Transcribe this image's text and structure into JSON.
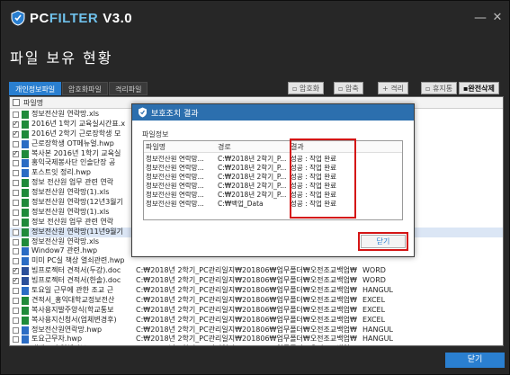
{
  "app": {
    "brand_pc": "PC",
    "brand_filter": "FILTER",
    "version": "V3.0",
    "page_title": "파일 보유 현황",
    "minimize_label": "—",
    "close_label": "✕"
  },
  "tabs": [
    {
      "label": "개인정보파일",
      "active": true
    },
    {
      "label": "암호화파일",
      "active": false
    },
    {
      "label": "격리파일",
      "active": false
    }
  ],
  "toolbar": {
    "encrypt": "암호화",
    "compress": "압축",
    "quarantine": "격리",
    "trash": "휴지통",
    "secure_delete": "완전삭제"
  },
  "list": {
    "header": "파일명",
    "rows": [
      {
        "name": "정보전산원 연락망.xls",
        "path": "",
        "type": "",
        "checked": false,
        "icon": "excel",
        "selected": false
      },
      {
        "name": "2016년 1학기 교육실시간표.x",
        "path": "",
        "type": "",
        "checked": true,
        "icon": "excel",
        "selected": false
      },
      {
        "name": "2016년 2학기 근로장학생 모",
        "path": "",
        "type": "",
        "checked": true,
        "icon": "excel",
        "selected": false
      },
      {
        "name": "근로장학생 OT메뉴얼.hwp",
        "path": "",
        "type": "",
        "checked": false,
        "icon": "hwp",
        "selected": false
      },
      {
        "name": "복사본 2016년 1학기 교육실",
        "path": "",
        "type": "",
        "checked": true,
        "icon": "excel",
        "selected": false
      },
      {
        "name": "홍익국제봉사단 인솔단장 공",
        "path": "",
        "type": "",
        "checked": false,
        "icon": "hwp",
        "selected": false
      },
      {
        "name": "포스트잇 정리.hwp",
        "path": "",
        "type": "",
        "checked": false,
        "icon": "hwp",
        "selected": false
      },
      {
        "name": "정보 전산원 업무 관련 연락",
        "path": "",
        "type": "",
        "checked": false,
        "icon": "excel",
        "selected": false
      },
      {
        "name": "정보전산원 연락망(1).xls",
        "path": "",
        "type": "",
        "checked": false,
        "icon": "excel",
        "selected": false
      },
      {
        "name": "정보전산원 연락망(12년3월기",
        "path": "",
        "type": "",
        "checked": false,
        "icon": "excel",
        "selected": false
      },
      {
        "name": "정보전산원 연락망(1).xls",
        "path": "",
        "type": "",
        "checked": false,
        "icon": "excel",
        "selected": false
      },
      {
        "name": "정보 전산원 업무 관련 연락",
        "path": "",
        "type": "",
        "checked": false,
        "icon": "excel",
        "selected": false
      },
      {
        "name": "정보전산원 연락망(11년9월기",
        "path": "",
        "type": "",
        "checked": false,
        "icon": "excel",
        "selected": true
      },
      {
        "name": "정보전산원 연락망.xls",
        "path": "",
        "type": "",
        "checked": false,
        "icon": "excel",
        "selected": false
      },
      {
        "name": "Window7 관련.hwp",
        "path": "",
        "type": "",
        "checked": false,
        "icon": "hwp",
        "selected": false
      },
      {
        "name": "미미 PC실 책상 열쇠관련.hwp",
        "path": "",
        "type": "",
        "checked": false,
        "icon": "hwp",
        "selected": false
      },
      {
        "name": "빔프로젝터 견적서(두강).doc",
        "path": "C:₩2018년 2학기_PC관리일지₩201806₩업무폴더₩오전조교백업₩",
        "type": "WORD",
        "checked": true,
        "icon": "word",
        "selected": false
      },
      {
        "name": "빔프로젝터 견적서(한솔).doc",
        "path": "C:₩2018년 2학기_PC관리일지₩201806₩업무폴더₩오전조교백업₩",
        "type": "WORD",
        "checked": true,
        "icon": "word",
        "selected": false
      },
      {
        "name": "토요일 근무에 관한 조교 근",
        "path": "C:₩2018년 2학기_PC관리일지₩201806₩업무폴더₩오전조교백업₩",
        "type": "HANGUL",
        "checked": false,
        "icon": "hwp",
        "selected": false
      },
      {
        "name": "견적서_홍익대학교정보전산",
        "path": "C:₩2018년 2학기_PC관리일지₩201806₩업무폴더₩오전조교백업₩",
        "type": "EXCEL",
        "checked": false,
        "icon": "excel",
        "selected": false
      },
      {
        "name": "복사용지발주양식(학교통보",
        "path": "C:₩2018년 2학기_PC관리일지₩201806₩업무폴더₩오전조교백업₩",
        "type": "EXCEL",
        "checked": false,
        "icon": "excel",
        "selected": false
      },
      {
        "name": "복사용지신청서(업체변경후)",
        "path": "C:₩2018년 2학기_PC관리일지₩201806₩업무폴더₩오전조교백업₩",
        "type": "EXCEL",
        "checked": false,
        "icon": "excel",
        "selected": false
      },
      {
        "name": "정보전산원연락망.hwp",
        "path": "C:₩2018년 2학기_PC관리일지₩201806₩업무폴더₩오전조교백업₩",
        "type": "HANGUL",
        "checked": false,
        "icon": "hwp",
        "selected": false
      },
      {
        "name": "토요근무자.hwp",
        "path": "C:₩2018년 2학기_PC관리일지₩201806₩업무폴더₩오전조교백업₩",
        "type": "HANGUL",
        "checked": false,
        "icon": "hwp",
        "selected": false
      },
      {
        "name": "재생토너 업체정보.xls",
        "path": "C:₩2018년 2학기_PC관리일지₩201806₩업무폴더₩오전조교백업₩",
        "type": "EXCEL",
        "checked": false,
        "icon": "excel",
        "selected": false
      }
    ]
  },
  "footer": {
    "close_button": "닫기"
  },
  "modal": {
    "title": "보호조치 결과",
    "subtitle": "파일정보",
    "columns": [
      "파일명",
      "경로",
      "결과"
    ],
    "rows": [
      {
        "name": "정보전산원 연락망...",
        "path": "C:₩2018년 2학기_P...",
        "result": "성공 : 작업 완료"
      },
      {
        "name": "정보전산원 연락망...",
        "path": "C:₩2018년 2학기_P...",
        "result": "성공 : 작업 완료"
      },
      {
        "name": "정보전산원 연락망...",
        "path": "C:₩2018년 2학기_P...",
        "result": "성공 : 작업 완료"
      },
      {
        "name": "정보전산원 연락망...",
        "path": "C:₩2018년 2학기_P...",
        "result": "성공 : 작업 완료"
      },
      {
        "name": "정보전산원 연락망...",
        "path": "C:₩2018년 2학기_P...",
        "result": "성공 : 작업 완료"
      },
      {
        "name": "정보전산원 연락망...",
        "path": "C:₩백업_Data",
        "result": "성공 : 작업 완료"
      }
    ],
    "close_button": "닫기"
  },
  "colors": {
    "accent": "#2a7fd0",
    "highlight": "#d41515",
    "window_bg": "#272727"
  }
}
